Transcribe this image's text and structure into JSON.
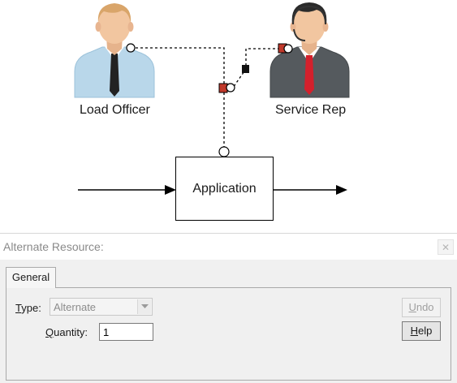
{
  "diagram": {
    "participants": [
      {
        "label": "Load Officer",
        "icon": "business-person-icon"
      },
      {
        "label": "Service Rep",
        "icon": "headset-agent-icon"
      }
    ],
    "activity": {
      "label": "Application"
    },
    "connector_colors": {
      "resource_marker": "#c0392b",
      "line": "#000000"
    }
  },
  "panel": {
    "title": "Alternate Resource:",
    "close_icon": "close-icon",
    "tab": "General",
    "type_label": "Type:",
    "type_value": "Alternate",
    "quantity_label": "Quantity:",
    "quantity_value": "1",
    "undo_label": "Undo",
    "help_label": "Help"
  }
}
